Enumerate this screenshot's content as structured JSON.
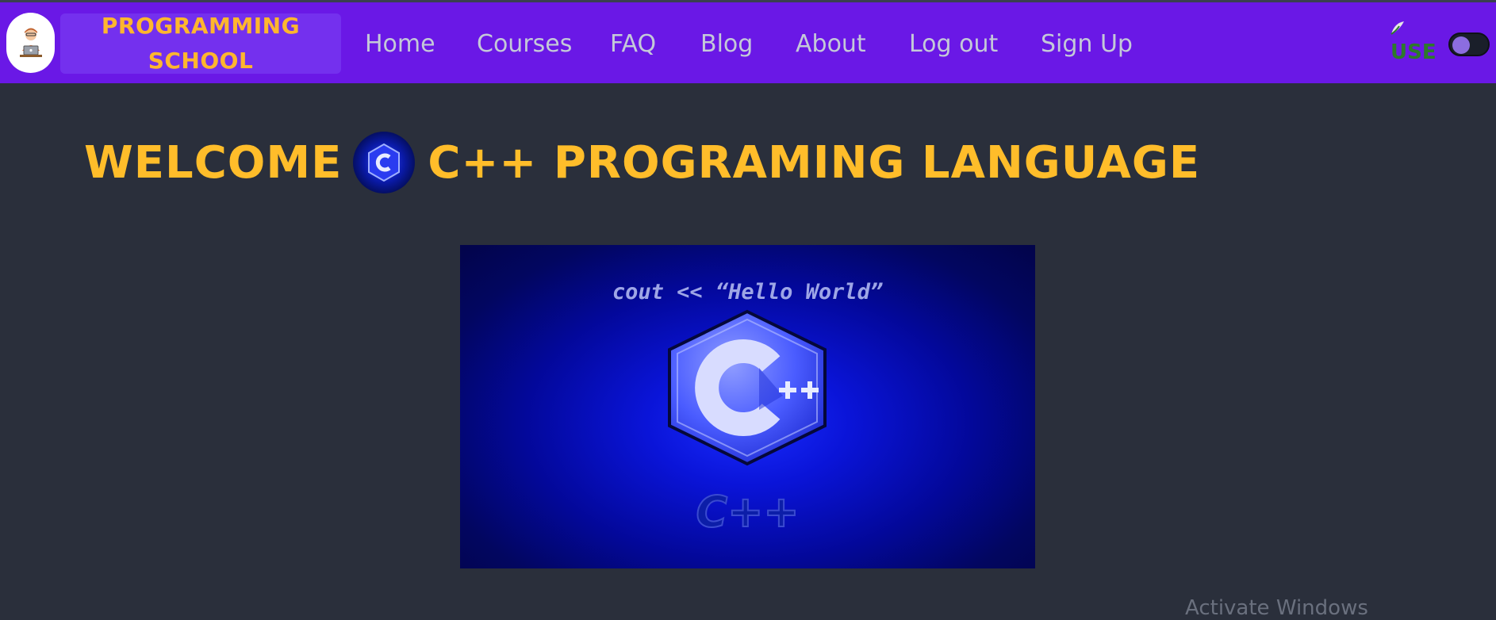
{
  "brand": {
    "line1": "PROGRAMMING",
    "line2": "SCHOOL",
    "logo_icon": "programmer-at-laptop-icon"
  },
  "nav": {
    "items": [
      {
        "label": "Home"
      },
      {
        "label": "Courses"
      },
      {
        "label": "FAQ"
      },
      {
        "label": "Blog"
      },
      {
        "label": "About"
      },
      {
        "label": "Log out"
      },
      {
        "label": "Sign Up"
      }
    ]
  },
  "user": {
    "label": "USE",
    "icon": "user-avatar-icon"
  },
  "theme_toggle": {
    "icon": "theme-toggle"
  },
  "page": {
    "title_left": "WELCOME",
    "title_right": "C++ PROGRAMING LANGUAGE",
    "title_icon": "cpp-logo-icon"
  },
  "hero": {
    "code_text": "cout << “Hello World”",
    "logo_text": "C++",
    "logo_plus": "++"
  },
  "os_overlay": {
    "watermark": "Activate Windows"
  },
  "colors": {
    "navbar": "#6a18e6",
    "accent": "#ffbd2a",
    "background": "#2a2f3b",
    "nav_text": "#c4c9d8"
  }
}
